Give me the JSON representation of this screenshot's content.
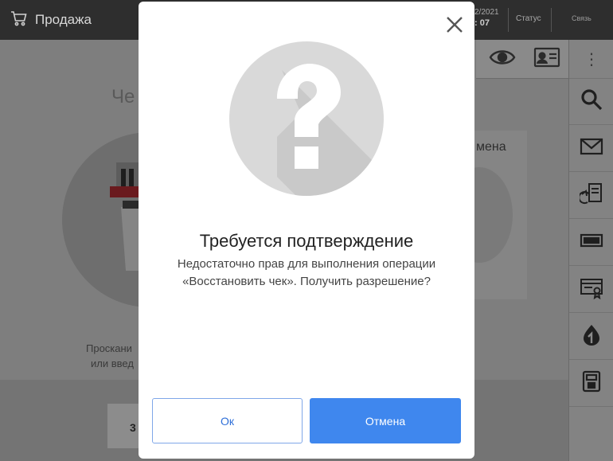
{
  "header": {
    "title": "Продажа",
    "cart_icon": "cart-icon",
    "date": "2/2021",
    "time": ": 07",
    "status_label": "Статус",
    "connection_label": "Связь"
  },
  "background": {
    "section_title": "Че",
    "scan_text_line1": "Проскани",
    "scan_text_line2": "или введ",
    "card_label": "мена",
    "key_label": "3"
  },
  "toolbar": {
    "icons": [
      "eye-icon",
      "id-card-icon"
    ]
  },
  "sidebar": {
    "more_label": "⋮",
    "items": [
      {
        "icon": "search-icon"
      },
      {
        "icon": "envelope-icon"
      },
      {
        "icon": "receipt-return-icon"
      },
      {
        "icon": "cash-drawer-icon"
      },
      {
        "icon": "certificate-card-icon"
      },
      {
        "icon": "coin-drop-icon"
      },
      {
        "icon": "payment-terminal-icon"
      }
    ]
  },
  "dialog": {
    "title": "Требуется подтверждение",
    "message_line1": "Недостаточно прав для выполнения операции",
    "message_line2": "«Восстановить чек». Получить разрешение?",
    "ok_label": "Ок",
    "cancel_label": "Отмена",
    "close_icon": "close-icon",
    "question_icon": "question-mark-icon"
  },
  "colors": {
    "accent": "#3f87ee",
    "topbar": "#2e2e2e",
    "overlay": "#7b7b7b"
  }
}
